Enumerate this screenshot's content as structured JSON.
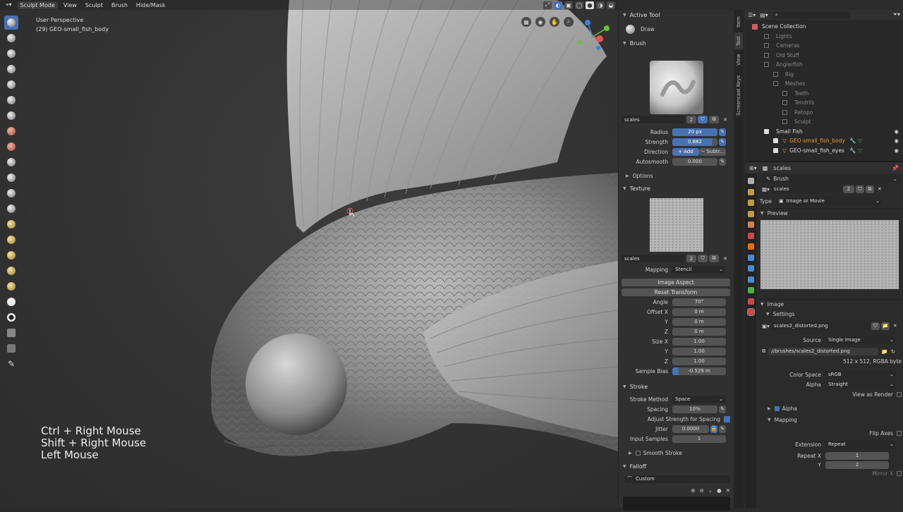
{
  "topbar": {
    "mode": "Sculpt Mode",
    "menus": [
      "View",
      "Sculpt",
      "Brush",
      "Hide/Mask"
    ]
  },
  "viewport": {
    "view_name": "User Perspective",
    "object_name": "(29) GEO-small_fish_body",
    "hints": [
      "Ctrl + Right Mouse",
      "Shift + Right Mouse",
      "Left Mouse"
    ]
  },
  "tool_panel": {
    "active_tool": {
      "header": "Active Tool",
      "name": "Draw"
    },
    "brush": {
      "header": "Brush",
      "name": "scales",
      "users": "2",
      "radius_label": "Radius",
      "radius": "20 px",
      "strength_label": "Strength",
      "strength": "0.882",
      "direction_label": "Direction",
      "add": "Add",
      "subtract": "Subtr...",
      "autosmooth_label": "Autosmooth",
      "autosmooth": "0.000",
      "options": "Options"
    },
    "texture": {
      "header": "Texture",
      "name": "scales",
      "users": "2",
      "mapping_label": "Mapping",
      "mapping": "Stencil",
      "image_aspect": "Image Aspect",
      "reset_transform": "Reset Transform",
      "angle_label": "Angle",
      "angle": "70°",
      "offset_x_label": "Offset X",
      "offset_x": "0 m",
      "offset_y_label": "Y",
      "offset_y": "0 m",
      "offset_z_label": "Z",
      "offset_z": "0 m",
      "size_x_label": "Size X",
      "size_x": "1.00",
      "size_y_label": "Y",
      "size_y": "1.00",
      "size_z_label": "Z",
      "size_z": "1.00",
      "sample_bias_label": "Sample Bias",
      "sample_bias": "-0.529 m",
      "sample_bias_fill": 0.12
    },
    "stroke": {
      "header": "Stroke",
      "method_label": "Stroke Method",
      "method": "Space",
      "spacing_label": "Spacing",
      "spacing": "10%",
      "adjust_strength": "Adjust Strength for Spacing",
      "jitter_label": "Jitter",
      "jitter": "0.0000",
      "input_samples_label": "Input Samples",
      "input_samples": "1",
      "smooth_stroke": "Smooth Stroke"
    },
    "falloff": {
      "header": "Falloff",
      "preset": "Custom"
    }
  },
  "side_tabs": [
    "Item",
    "Tool",
    "View",
    "Screencast Keys"
  ],
  "outliner": {
    "root": "Scene Collection",
    "items": [
      {
        "name": "Lights",
        "indent": 1,
        "state": "dim"
      },
      {
        "name": "Cameras",
        "indent": 1,
        "state": "dim"
      },
      {
        "name": "Old Stuff",
        "indent": 1,
        "state": "dim"
      },
      {
        "name": "Anglerfish",
        "indent": 1,
        "state": "dim"
      },
      {
        "name": "Rig",
        "indent": 2,
        "state": "dim"
      },
      {
        "name": "Meshes",
        "indent": 2,
        "state": "dim"
      },
      {
        "name": "Teeth",
        "indent": 3,
        "state": "dim"
      },
      {
        "name": "Tendrils",
        "indent": 3,
        "state": "dim"
      },
      {
        "name": "Retopo",
        "indent": 3,
        "state": "dim"
      },
      {
        "name": "Sculpt",
        "indent": 3,
        "state": "dim"
      },
      {
        "name": "Small Fish",
        "indent": 1,
        "state": "on"
      },
      {
        "name": "GEO-small_fish_body",
        "indent": 2,
        "state": "sel"
      },
      {
        "name": "GEO-small_fish_eyes",
        "indent": 2,
        "state": "on"
      }
    ]
  },
  "properties": {
    "header_name": "scales",
    "brush_label": "Brush",
    "texture_name": "scales",
    "texture_users": "2",
    "type_label": "Type",
    "type_value": "Image or Movie",
    "preview_label": "Preview",
    "image_label": "Image",
    "settings_label": "Settings",
    "image_name": "scales2_distorted.png",
    "source_label": "Source",
    "source_value": "Single Image",
    "filepath": "//brushes/scales2_distorted.png",
    "image_info": "512 x 512,  RGBA byte",
    "color_space_label": "Color Space",
    "color_space": "sRGB",
    "alpha_label": "Alpha",
    "alpha_value": "Straight",
    "view_as_render": "View as Render",
    "alpha_panel": "Alpha",
    "mapping_panel": "Mapping",
    "flip_axes": "Flip Axes",
    "extension_label": "Extension",
    "extension": "Repeat",
    "repeat_x_label": "Repeat X",
    "repeat_x": "1",
    "repeat_y_label": "Y",
    "repeat_y": "2",
    "mirror_x": "Mirror X"
  },
  "colors": {
    "accent_blue": "#4772b3",
    "selected_orange": "#e59b3c",
    "panel_bg": "#303030"
  }
}
